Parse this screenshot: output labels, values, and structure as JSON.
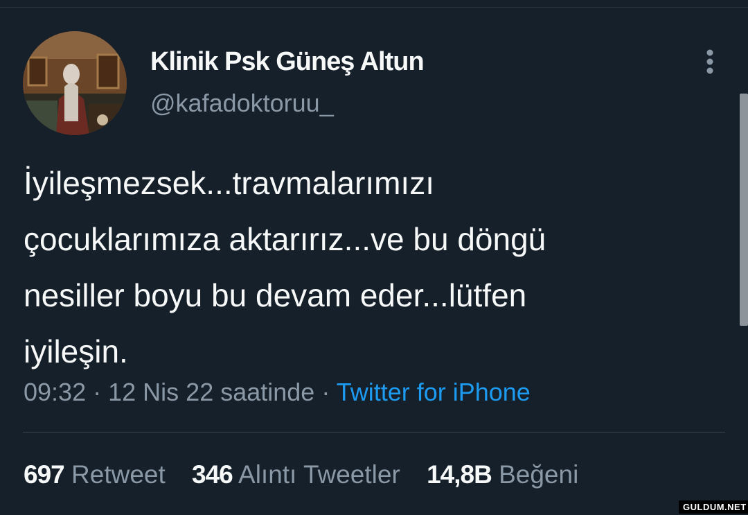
{
  "user": {
    "display_name": "Klinik Psk Güneş Altun",
    "handle": "@kafadoktoruu_"
  },
  "tweet": {
    "lines": [
      "İyileşmezsek...travmalarımızı",
      "çocuklarımıza aktarırız...ve bu döngü",
      "nesiller boyu bu devam eder...lütfen",
      "iyileşin."
    ]
  },
  "meta": {
    "time": "09:32",
    "separator": "·",
    "date": "12 Nis 22 saatinde",
    "source": "Twitter for iPhone"
  },
  "stats": {
    "retweets": {
      "count": "697",
      "label": "Retweet"
    },
    "quotes": {
      "count": "346",
      "label": "Alıntı Tweetler"
    },
    "likes": {
      "count": "14,8B",
      "label": "Beğeni"
    }
  },
  "watermark": "GULDUM.NET",
  "icons": {
    "more": "more-vertical-icon"
  },
  "colors": {
    "background": "#15202b",
    "text": "#f7f9f9",
    "secondary": "#8b98a5",
    "link": "#1d9bf0"
  }
}
